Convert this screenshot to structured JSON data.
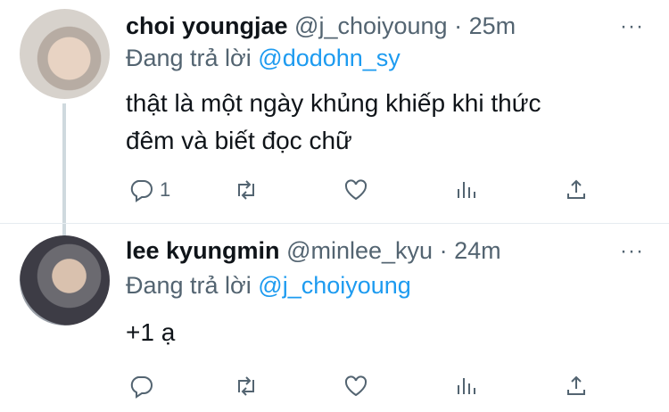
{
  "tweets": [
    {
      "name": "choi youngjae",
      "handle": "@j_choiyoung",
      "separator": "·",
      "time": "25m",
      "more": "···",
      "reply_prefix": "Đang trả lời",
      "reply_to": "@dodohn_sy",
      "text_line1": "thật là một ngày khủng khiếp khi thức",
      "text_line2": "đêm và biết đọc chữ",
      "reply_count": "1"
    },
    {
      "name": "lee kyungmin",
      "handle": "@minlee_kyu",
      "separator": "·",
      "time": "24m",
      "more": "···",
      "reply_prefix": "Đang trả lời",
      "reply_to": "@j_choiyoung",
      "text_line1": "+1 ạ",
      "reply_count": ""
    }
  ],
  "icons": [
    "reply-icon",
    "retweet-icon",
    "like-icon",
    "views-icon",
    "share-icon"
  ],
  "colors": {
    "accent": "#1d9bf0",
    "muted": "#536471",
    "text": "#0f1419"
  }
}
